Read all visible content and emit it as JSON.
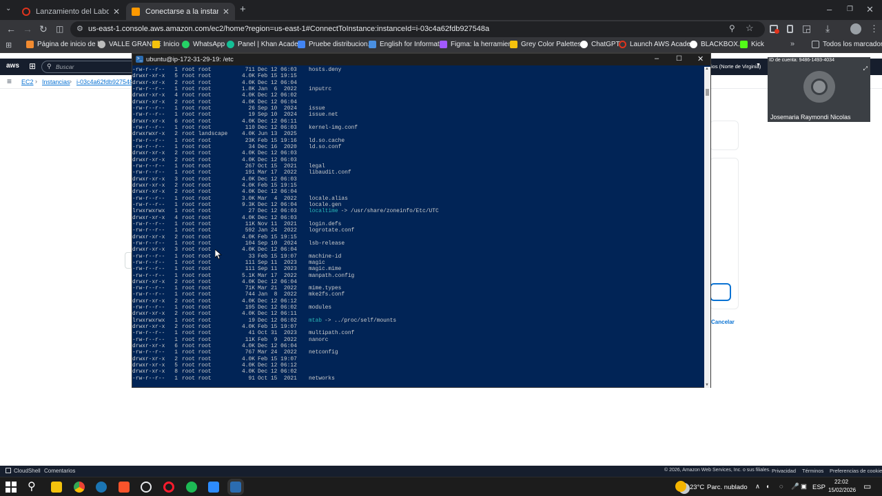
{
  "browser": {
    "tabs": [
      {
        "label": "Lanzamiento del Laboratorio de",
        "active": false,
        "color": "#e0341d"
      },
      {
        "label": "Conectarse a la instancia | EC2",
        "active": true,
        "color": "#ff9900"
      }
    ],
    "url": "us-east-1.console.aws.amazon.com/ec2/home?region=us-east-1#ConnectToInstance:instanceId=i-03c4a62fdb927548a",
    "bookmarks": [
      {
        "label": "Página de inicio de l...",
        "color": "#f28b30"
      },
      {
        "label": "VALLE GRANDE",
        "color": "#bdbdbd"
      },
      {
        "label": "Inicio",
        "color": "#f4c20d"
      },
      {
        "label": "WhatsApp",
        "color": "#25d366"
      },
      {
        "label": "Panel | Khan Acade...",
        "color": "#14bf96"
      },
      {
        "label": "Pruebe distribucion...",
        "color": "#4285f4"
      },
      {
        "label": "English for Informat...",
        "color": "#4a90e2"
      },
      {
        "label": "Figma: la herramien...",
        "color": "#a259ff"
      },
      {
        "label": "Grey Color Palettes...",
        "color": "#f4c20d"
      },
      {
        "label": "ChatGPT",
        "color": "#ffffff"
      },
      {
        "label": "Launch AWS Acade...",
        "color": "#e0341d"
      },
      {
        "label": "BLACKBOX.AI",
        "color": "#ffffff"
      },
      {
        "label": "Kick",
        "color": "#53fc18"
      }
    ],
    "all_bookmarks": "Todos los marcadores"
  },
  "aws": {
    "search_placeholder": "Buscar",
    "region": "ios (Norte de Virginia)",
    "crumbs": [
      "EC2",
      "Instancias",
      "i-03c4a62fdb927548a"
    ],
    "cancel": "Cancelar",
    "footer": {
      "cloudshell": "CloudShell",
      "comments": "Comentarios",
      "copyright": "© 2026, Amazon Web Services, Inc. o sus filiales.",
      "privacy": "Privacidad",
      "terms": "Términos",
      "cookies": "Preferencias de cookies"
    }
  },
  "video": {
    "account": "ID de cuenta: 9486-1493-4034",
    "participant": "Josemaria Raymondi Nicolas"
  },
  "terminal": {
    "title": "ubuntu@ip-172-31-29-19: /etc",
    "lines": [
      [
        "-rw-r--r--",
        "1",
        "root root",
        "711",
        "Dec 12 06:03",
        "hosts.deny",
        "file",
        ""
      ],
      [
        "drwxr-xr-x",
        "5",
        "root root",
        "4.0K",
        "Feb 15 19:15",
        "",
        "dir",
        ""
      ],
      [
        "drwxr-xr-x",
        "2",
        "root root",
        "4.0K",
        "Dec 12 06:04",
        "",
        "dir",
        ""
      ],
      [
        "-rw-r--r--",
        "1",
        "root root",
        "1.8K",
        "Jan  6  2022",
        "inputrc",
        "file",
        ""
      ],
      [
        "drwxr-xr-x",
        "4",
        "root root",
        "4.0K",
        "Dec 12 06:02",
        "",
        "dir",
        ""
      ],
      [
        "drwxr-xr-x",
        "2",
        "root root",
        "4.0K",
        "Dec 12 06:04",
        "",
        "dir",
        ""
      ],
      [
        "-rw-r--r--",
        "1",
        "root root",
        "26",
        "Sep 10  2024",
        "issue",
        "file",
        ""
      ],
      [
        "-rw-r--r--",
        "1",
        "root root",
        "19",
        "Sep 10  2024",
        "issue.net",
        "file",
        ""
      ],
      [
        "drwxr-xr-x",
        "6",
        "root root",
        "4.0K",
        "Dec 12 06:11",
        "",
        "dir",
        ""
      ],
      [
        "-rw-r--r--",
        "1",
        "root root",
        "110",
        "Dec 12 06:03",
        "kernel-img.conf",
        "file",
        ""
      ],
      [
        "drwxrwxr-x",
        "2",
        "root landscape",
        "4.0K",
        "Jun 13  2025",
        "",
        "dir",
        ""
      ],
      [
        "-rw-r--r--",
        "1",
        "root root",
        "23K",
        "Feb 15 19:16",
        "ld.so.cache",
        "file",
        ""
      ],
      [
        "-rw-r--r--",
        "1",
        "root root",
        "34",
        "Dec 16  2020",
        "ld.so.conf",
        "file",
        ""
      ],
      [
        "drwxr-xr-x",
        "2",
        "root root",
        "4.0K",
        "Dec 12 06:03",
        "",
        "dir",
        ""
      ],
      [
        "drwxr-xr-x",
        "2",
        "root root",
        "4.0K",
        "Dec 12 06:03",
        "",
        "dir",
        ""
      ],
      [
        "-rw-r--r--",
        "1",
        "root root",
        "267",
        "Oct 15  2021",
        "legal",
        "file",
        ""
      ],
      [
        "-rw-r--r--",
        "1",
        "root root",
        "191",
        "Mar 17  2022",
        "libaudit.conf",
        "file",
        ""
      ],
      [
        "drwxr-xr-x",
        "3",
        "root root",
        "4.0K",
        "Dec 12 06:03",
        "",
        "dir",
        ""
      ],
      [
        "drwxr-xr-x",
        "2",
        "root root",
        "4.0K",
        "Feb 15 19:15",
        "",
        "dir",
        ""
      ],
      [
        "drwxr-xr-x",
        "2",
        "root root",
        "4.0K",
        "Dec 12 06:04",
        "",
        "dir",
        ""
      ],
      [
        "-rw-r--r--",
        "1",
        "root root",
        "3.0K",
        "Mar  4  2022",
        "locale.alias",
        "file",
        ""
      ],
      [
        "-rw-r--r--",
        "1",
        "root root",
        "9.3K",
        "Dec 12 06:04",
        "locale.gen",
        "file",
        ""
      ],
      [
        "lrwxrwxrwx",
        "1",
        "root root",
        "27",
        "Dec 12 06:03",
        "localtime",
        "sym",
        "-> /usr/share/zoneinfo/Etc/UTC"
      ],
      [
        "drwxr-xr-x",
        "4",
        "root root",
        "4.0K",
        "Dec 12 06:03",
        "",
        "dir",
        ""
      ],
      [
        "-rw-r--r--",
        "1",
        "root root",
        "11K",
        "Nov 11  2021",
        "login.defs",
        "file",
        ""
      ],
      [
        "-rw-r--r--",
        "1",
        "root root",
        "592",
        "Jan 24  2022",
        "logrotate.conf",
        "file",
        ""
      ],
      [
        "drwxr-xr-x",
        "2",
        "root root",
        "4.0K",
        "Feb 15 19:15",
        "",
        "dir",
        ""
      ],
      [
        "-rw-r--r--",
        "1",
        "root root",
        "104",
        "Sep 10  2024",
        "lsb-release",
        "file",
        ""
      ],
      [
        "drwxr-xr-x",
        "3",
        "root root",
        "4.0K",
        "Dec 12 06:04",
        "",
        "dir",
        ""
      ],
      [
        "-rw-r--r--",
        "1",
        "root root",
        "33",
        "Feb 15 19:07",
        "machine-id",
        "file",
        ""
      ],
      [
        "-rw-r--r--",
        "1",
        "root root",
        "111",
        "Sep 11  2023",
        "magic",
        "file",
        ""
      ],
      [
        "-rw-r--r--",
        "1",
        "root root",
        "111",
        "Sep 11  2023",
        "magic.mime",
        "file",
        ""
      ],
      [
        "-rw-r--r--",
        "1",
        "root root",
        "5.1K",
        "Mar 17  2022",
        "manpath.config",
        "file",
        ""
      ],
      [
        "drwxr-xr-x",
        "2",
        "root root",
        "4.0K",
        "Dec 12 06:04",
        "",
        "dir",
        ""
      ],
      [
        "-rw-r--r--",
        "1",
        "root root",
        "71K",
        "Mar 21  2022",
        "mime.types",
        "file",
        ""
      ],
      [
        "-rw-r--r--",
        "1",
        "root root",
        "744",
        "Jan  8  2022",
        "mke2fs.conf",
        "file",
        ""
      ],
      [
        "drwxr-xr-x",
        "2",
        "root root",
        "4.0K",
        "Dec 12 06:12",
        "",
        "dir",
        ""
      ],
      [
        "-rw-r--r--",
        "1",
        "root root",
        "195",
        "Dec 12 06:02",
        "modules",
        "file",
        ""
      ],
      [
        "drwxr-xr-x",
        "2",
        "root root",
        "4.0K",
        "Dec 12 06:11",
        "",
        "dir",
        ""
      ],
      [
        "lrwxrwxrwx",
        "1",
        "root root",
        "19",
        "Dec 12 06:02",
        "mtab",
        "sym",
        "-> ../proc/self/mounts"
      ],
      [
        "drwxr-xr-x",
        "2",
        "root root",
        "4.0K",
        "Feb 15 19:07",
        "",
        "dir",
        ""
      ],
      [
        "-rw-r--r--",
        "1",
        "root root",
        "41",
        "Oct 31  2023",
        "multipath.conf",
        "file",
        ""
      ],
      [
        "-rw-r--r--",
        "1",
        "root root",
        "11K",
        "Feb  9  2022",
        "nanorc",
        "file",
        ""
      ],
      [
        "drwxr-xr-x",
        "6",
        "root root",
        "4.0K",
        "Dec 12 06:04",
        "",
        "dir",
        ""
      ],
      [
        "-rw-r--r--",
        "1",
        "root root",
        "767",
        "Mar 24  2022",
        "netconfig",
        "file",
        ""
      ],
      [
        "drwxr-xr-x",
        "2",
        "root root",
        "4.0K",
        "Feb 15 19:07",
        "",
        "dir",
        ""
      ],
      [
        "drwxr-xr-x",
        "5",
        "root root",
        "4.0K",
        "Dec 12 06:12",
        "",
        "dir",
        ""
      ],
      [
        "drwxr-xr-x",
        "8",
        "root root",
        "4.0K",
        "Dec 12 06:02",
        "",
        "dir",
        ""
      ],
      [
        "-rw-r--r--",
        "1",
        "root root",
        "91",
        "Oct 15  2021",
        "networks",
        "file",
        ""
      ]
    ]
  },
  "taskbar": {
    "weather": "23°C",
    "weather_desc": "Parc. nublado",
    "lang": "ESP",
    "time": "22:02",
    "date": "15/02/2026"
  }
}
